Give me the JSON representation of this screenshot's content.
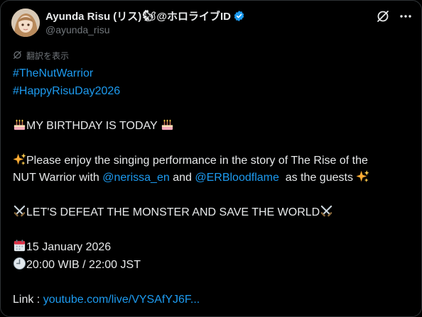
{
  "header": {
    "display_name": "Ayunda Risu (リス)",
    "display_name_suffix": "@ホロライブID",
    "squirrel_emoji": "🐿",
    "handle": "@ayunda_risu",
    "verified_color": "#1d9bf0"
  },
  "translate_label": "翻訳を表示",
  "tweet": {
    "hashtags": [
      "#TheNutWarrior",
      "#HappyRisuDay2026"
    ],
    "birthday_line": "MY BIRTHDAY IS TODAY",
    "enjoy_text_1": "Please enjoy the singing performance in the story of The Rise of the",
    "enjoy_text_2": "NUT Warrior with",
    "mention_1": "@nerissa_en",
    "and_text": "and",
    "mention_2": "@ERBloodflame",
    "guests_text": "as the guests",
    "defeat_line": "LET'S DEFEAT THE MONSTER AND SAVE THE WORLD",
    "date_line": "15 January 2026",
    "time_line": "20:00 WIB / 22:00 JST",
    "link_label": "Link : ",
    "link_text": "youtube.com/live/VYSAfYJ6F..."
  },
  "colors": {
    "background": "#000000",
    "text": "#e7e9ea",
    "muted": "#71767b",
    "accent": "#1d9bf0"
  },
  "icons": [
    "grok-icon",
    "more-icon",
    "translate-icon",
    "verified-badge-icon",
    "cake-emoji",
    "sparkles-emoji",
    "crossed-swords-emoji",
    "calendar-emoji",
    "clock-emoji"
  ]
}
